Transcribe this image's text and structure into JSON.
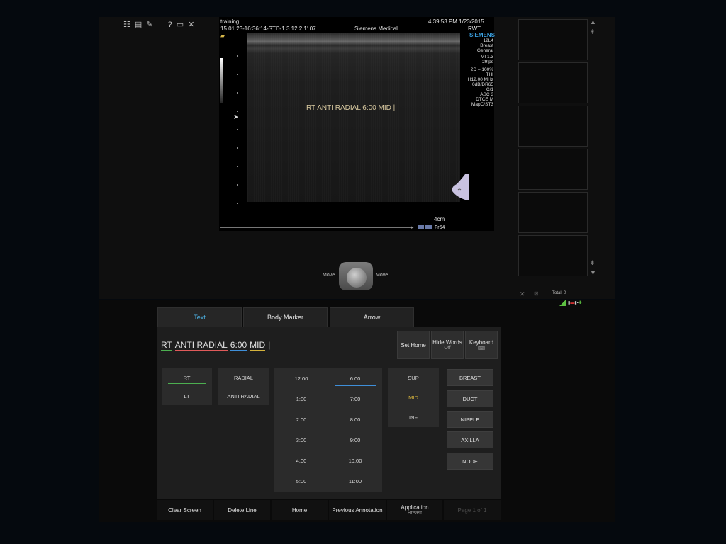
{
  "header": {
    "study": "training",
    "study_id": "15.01.23-16:36:14-STD-1.3.12.2.1107....",
    "manufacturer_line": "Siemens Medical",
    "datetime": "4:39:53 PM 1/23/2015",
    "operator": "RWT",
    "brand": "SIEMENS"
  },
  "params": [
    "12L4",
    "Breast",
    "General",
    "MI 1.3",
    "29fps",
    "2D – 100%",
    "THI",
    "H12.00 MHz",
    "0dB/DR65",
    "C/1",
    "ASC 3",
    "DTCE M",
    "MapC/ST3"
  ],
  "image": {
    "depth": "4cm",
    "frame": "Fr64",
    "annotation": "RT ANTI RADIAL 6:00 MID |"
  },
  "trackball": {
    "left_label": "Move",
    "right_label": "Move"
  },
  "clip_bar": {
    "total": "Total: 0"
  },
  "tabs": [
    {
      "label": "Text",
      "active": true
    },
    {
      "label": "Body Marker"
    },
    {
      "label": "Arrow"
    }
  ],
  "annotation_text": {
    "words": [
      {
        "text": "RT",
        "color": "#4caf50"
      },
      {
        "text": "ANTI RADIAL",
        "color": "#e05a5a"
      },
      {
        "text": "6:00",
        "color": "#3f8fd9"
      },
      {
        "text": "MID",
        "color": "#d4b23c"
      }
    ],
    "cursor": "|"
  },
  "controls": {
    "set_home": "Set Home",
    "hide_words": "Hide Words",
    "hide_words_value": "Off",
    "keyboard": "Keyboard"
  },
  "side_options": [
    {
      "label": "RT",
      "selected": true,
      "color": "#4caf50"
    },
    {
      "label": "LT"
    }
  ],
  "orientation_options": [
    {
      "label": "RADIAL"
    },
    {
      "label": "ANTI RADIAL",
      "selected": true,
      "color": "#e05a5a"
    }
  ],
  "clock_left": [
    "12:00",
    "1:00",
    "2:00",
    "3:00",
    "4:00",
    "5:00"
  ],
  "clock_right": [
    "6:00",
    "7:00",
    "8:00",
    "9:00",
    "10:00",
    "11:00"
  ],
  "clock_selected": "6:00",
  "clock_selected_color": "#3f8fd9",
  "depth_options": [
    {
      "label": "SUP"
    },
    {
      "label": "MID",
      "selected": true,
      "color": "#d4b23c"
    },
    {
      "label": "INF"
    }
  ],
  "anatomy": [
    "BREAST",
    "DUCT",
    "NIPPLE",
    "AXILLA",
    "NODE"
  ],
  "bottom_bar": {
    "clear_screen": "Clear Screen",
    "delete_line": "Delete Line",
    "home": "Home",
    "previous_annotation": "Previous Annotation",
    "application": "Application",
    "application_value": "Breast",
    "page": "Page 1 of 1"
  },
  "colors": {
    "accent": "#4db3e6",
    "brand": "#3aa0e0"
  }
}
